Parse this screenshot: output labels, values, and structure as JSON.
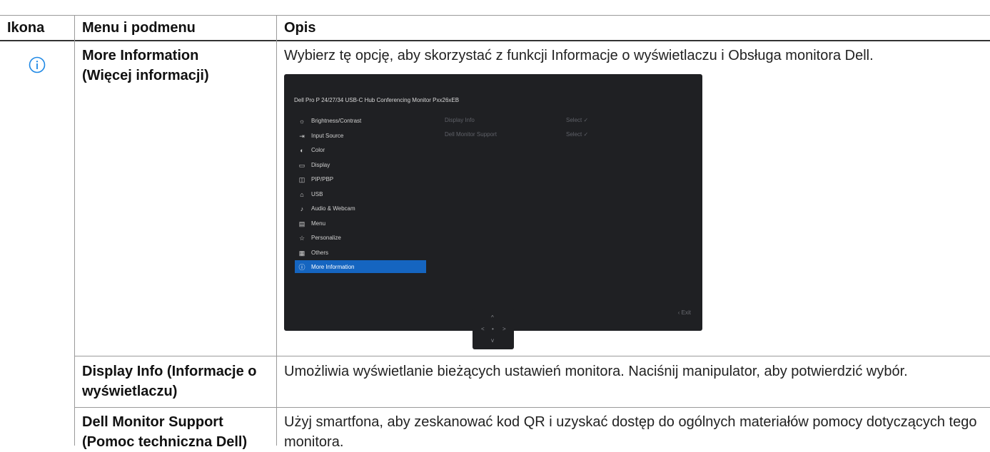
{
  "table": {
    "headers": {
      "icon": "Ikona",
      "menu": "Menu i podmenu",
      "desc": "Opis"
    },
    "rows": [
      {
        "icon": "info-circle-icon",
        "menu": "More Information\n(Więcej informacji)",
        "desc": "Wybierz tę opcję, aby skorzystać z funkcji Informacje o wyświetlaczu i Obsługa monitora Dell."
      },
      {
        "menu": "Display Info (Informacje o wyświetlaczu)",
        "desc": "Umożliwia wyświetlanie bieżących ustawień monitora. Naciśnij manipulator, aby potwierdzić wybór."
      },
      {
        "menu": "Dell Monitor Support (Pomoc techniczna Dell)",
        "desc": "Użyj smartfona, aby zeskanować kod QR i uzyskać dostęp do ogólnych materiałów pomocy dotyczących tego monitora."
      }
    ]
  },
  "osd": {
    "title": "Dell Pro P 24/27/34 USB-C Hub Conferencing Monitor  Pxx26xEB",
    "menu_items": [
      {
        "icon": "brightness-icon",
        "glyph": "☼",
        "label": "Brightness/Contrast"
      },
      {
        "icon": "input-source-icon",
        "glyph": "⇥",
        "label": "Input Source"
      },
      {
        "icon": "color-icon",
        "glyph": "◐",
        "label": "Color"
      },
      {
        "icon": "display-icon",
        "glyph": "▭",
        "label": "Display"
      },
      {
        "icon": "pip-pbp-icon",
        "glyph": "◫",
        "label": "PIP/PBP"
      },
      {
        "icon": "usb-icon",
        "glyph": "⌂",
        "label": "USB"
      },
      {
        "icon": "audio-webcam-icon",
        "glyph": "♪",
        "label": "Audio & Webcam"
      },
      {
        "icon": "menu-icon",
        "glyph": "▤",
        "label": "Menu"
      },
      {
        "icon": "personalize-icon",
        "glyph": "☆",
        "label": "Personalize"
      },
      {
        "icon": "others-icon",
        "glyph": "▦",
        "label": "Others"
      },
      {
        "icon": "info-icon",
        "glyph": "ⓘ",
        "label": "More Information",
        "selected": true
      }
    ],
    "submenu": [
      {
        "label": "Display Info",
        "value": "Select ✓"
      },
      {
        "label": "Dell Monitor Support",
        "value": "Select ✓"
      }
    ],
    "exit_label": "‹ Exit",
    "joystick": {
      "up": "^",
      "left": "<",
      "center": "•",
      "right": ">",
      "down": "v"
    }
  },
  "colors": {
    "accent": "#1565c0",
    "osd_bg": "#1f2023",
    "info_icon": "#1e88e5"
  }
}
